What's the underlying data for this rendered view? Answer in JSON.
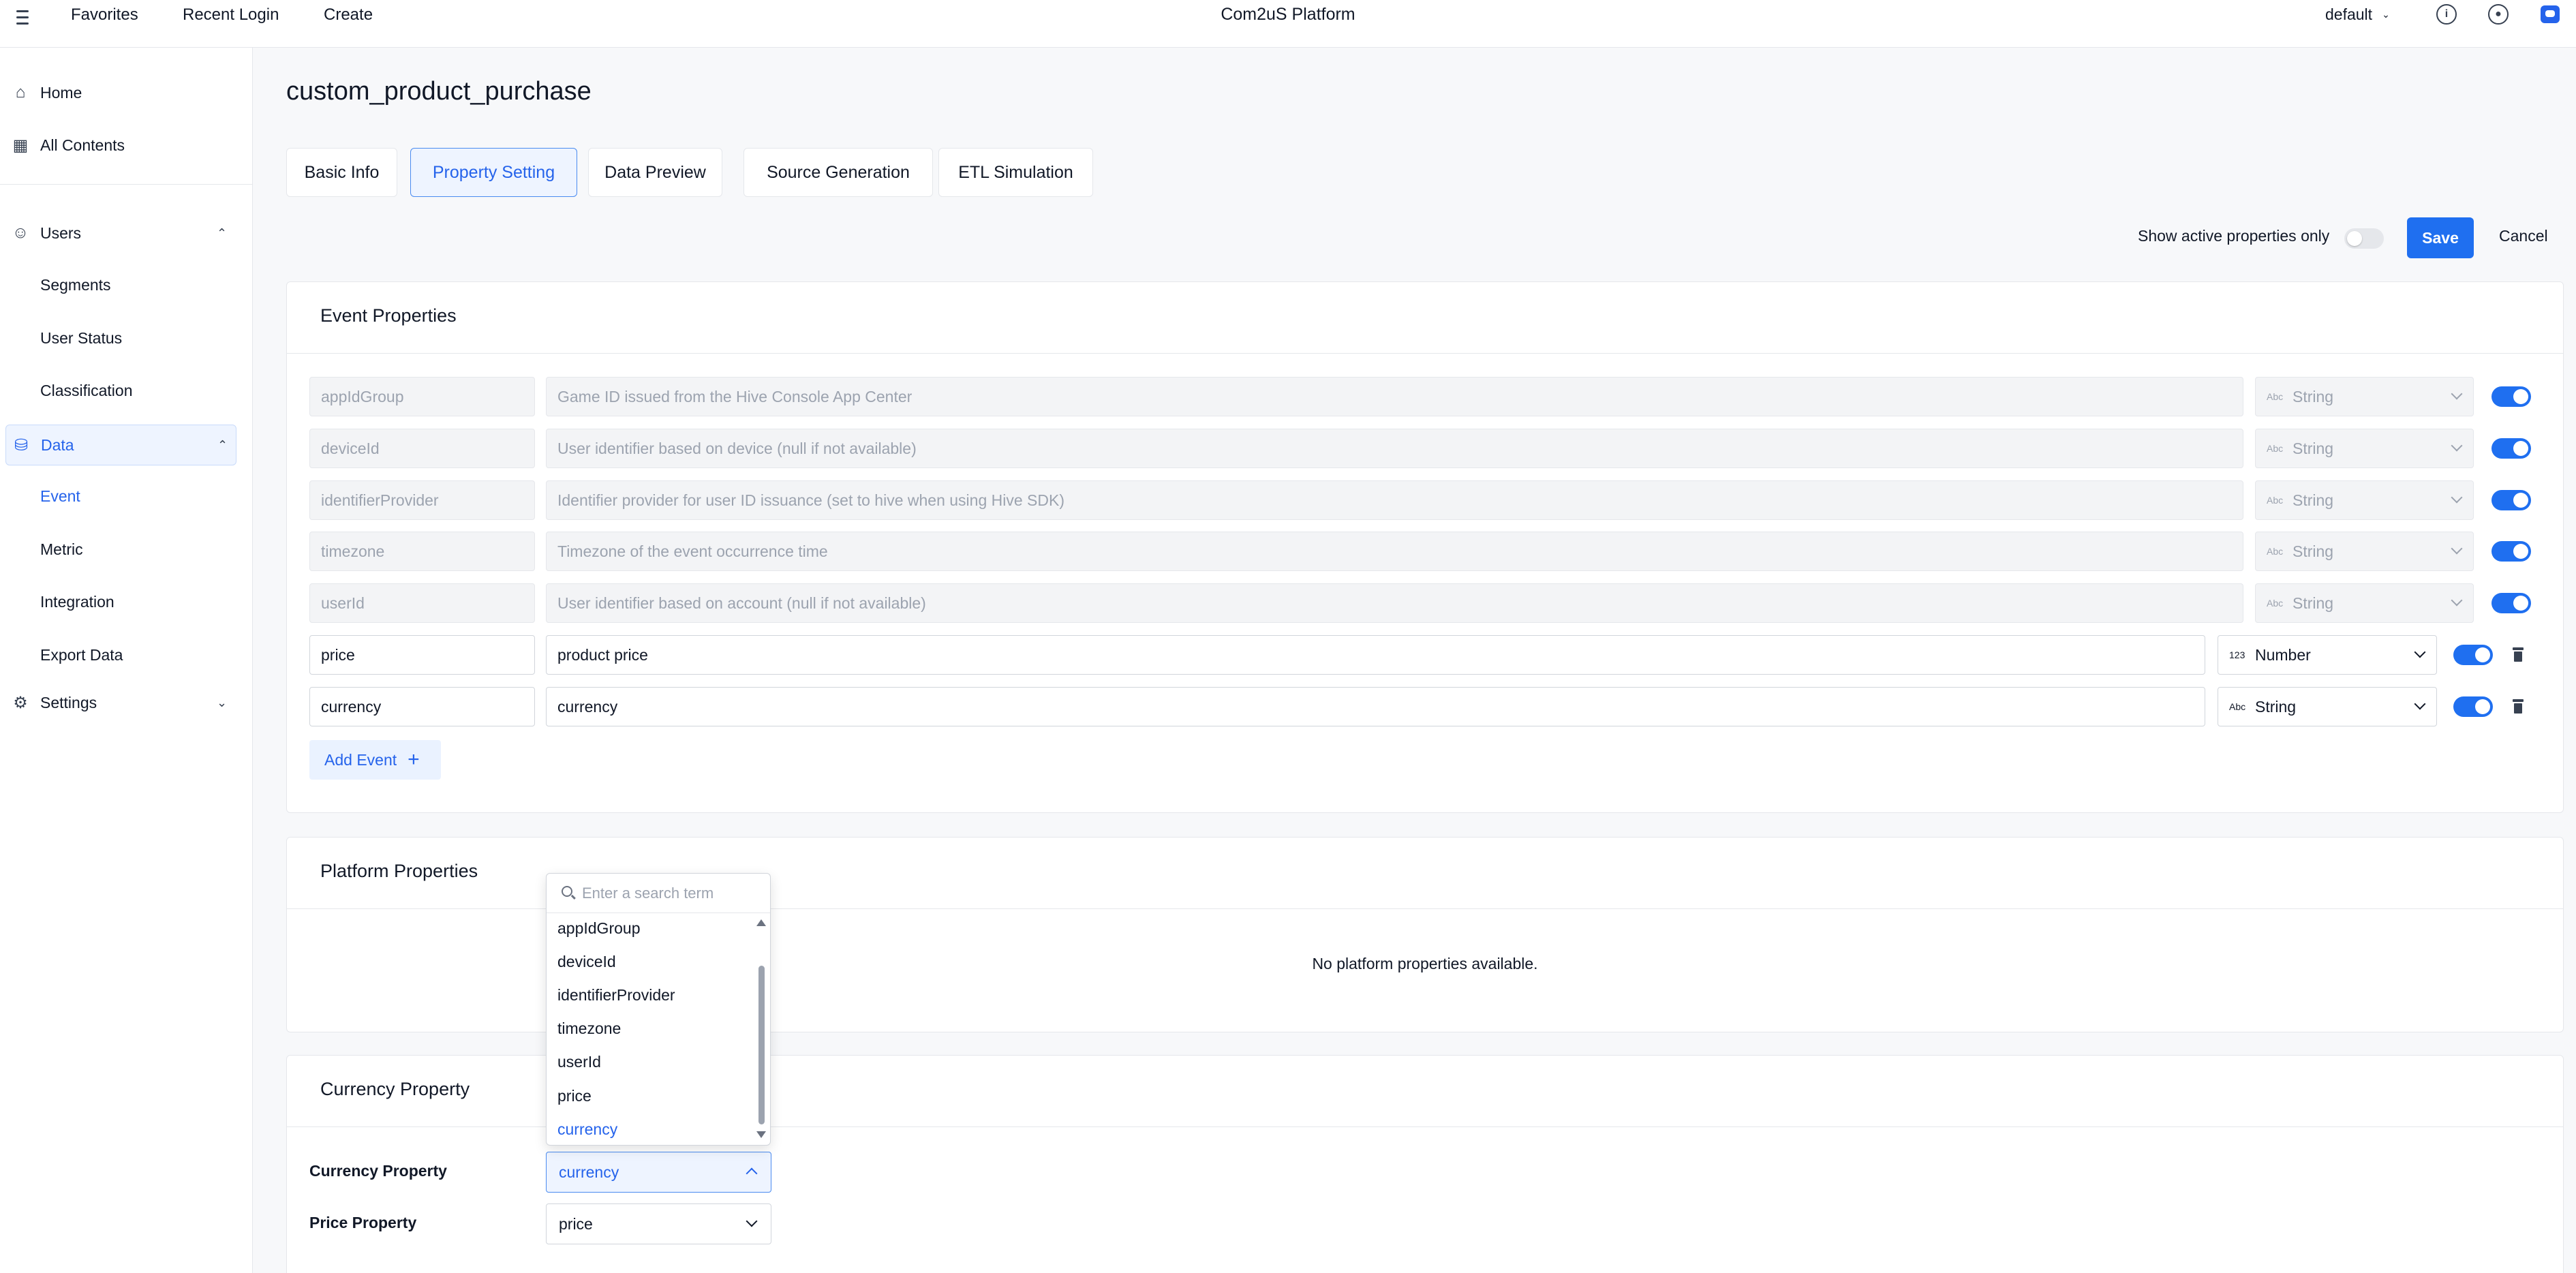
{
  "topbar": {
    "favorites": "Favorites",
    "recent_login": "Recent Login",
    "create": "Create",
    "platform_title": "Com2uS Platform",
    "workspace": "default",
    "brand_color": "#2563eb"
  },
  "sidebar": {
    "home": "Home",
    "all_contents": "All Contents",
    "users": "Users",
    "users_sub": [
      "Segments",
      "User Status",
      "Classification"
    ],
    "data": "Data",
    "data_sub": [
      "Event",
      "Metric",
      "Integration",
      "Export Data"
    ],
    "settings": "Settings"
  },
  "page": {
    "title": "custom_product_purchase",
    "tabs": [
      "Basic Info",
      "Property Setting",
      "Data Preview",
      "Source Generation",
      "ETL Simulation"
    ],
    "active_tab": "Property Setting",
    "show_active_label": "Show active properties only",
    "show_active_on": false,
    "save": "Save",
    "cancel": "Cancel",
    "accent_color": "#1f6ff0"
  },
  "event_properties": {
    "title": "Event Properties",
    "rows": [
      {
        "name": "appIdGroup",
        "description": "Game ID issued from the Hive Console App Center",
        "type_icon": "Abc",
        "type": "String",
        "enabled": true,
        "locked": true
      },
      {
        "name": "deviceId",
        "description": "User identifier based on device (null if not available)",
        "type_icon": "Abc",
        "type": "String",
        "enabled": true,
        "locked": true
      },
      {
        "name": "identifierProvider",
        "description": "Identifier provider for user ID issuance (set to hive when using Hive SDK)",
        "type_icon": "Abc",
        "type": "String",
        "enabled": true,
        "locked": true
      },
      {
        "name": "timezone",
        "description": "Timezone of the event occurrence time",
        "type_icon": "Abc",
        "type": "String",
        "enabled": true,
        "locked": true
      },
      {
        "name": "userId",
        "description": "User identifier based on account (null if not available)",
        "type_icon": "Abc",
        "type": "String",
        "enabled": true,
        "locked": true
      },
      {
        "name": "price",
        "description": "product price",
        "type_icon": "123",
        "type": "Number",
        "enabled": true,
        "locked": false
      },
      {
        "name": "currency",
        "description": "currency",
        "type_icon": "Abc",
        "type": "String",
        "enabled": true,
        "locked": false
      }
    ],
    "add_event": "Add Event"
  },
  "platform_properties": {
    "title": "Platform Properties",
    "empty": "No platform properties available."
  },
  "currency_property": {
    "title": "Currency Property",
    "currency_label": "Currency Property",
    "currency_value": "currency",
    "price_label": "Price Property",
    "price_value": "price"
  },
  "dropdown": {
    "placeholder": "Enter a search term",
    "options": [
      "appIdGroup",
      "deviceId",
      "identifierProvider",
      "timezone",
      "userId",
      "price",
      "currency"
    ],
    "selected": "currency"
  }
}
